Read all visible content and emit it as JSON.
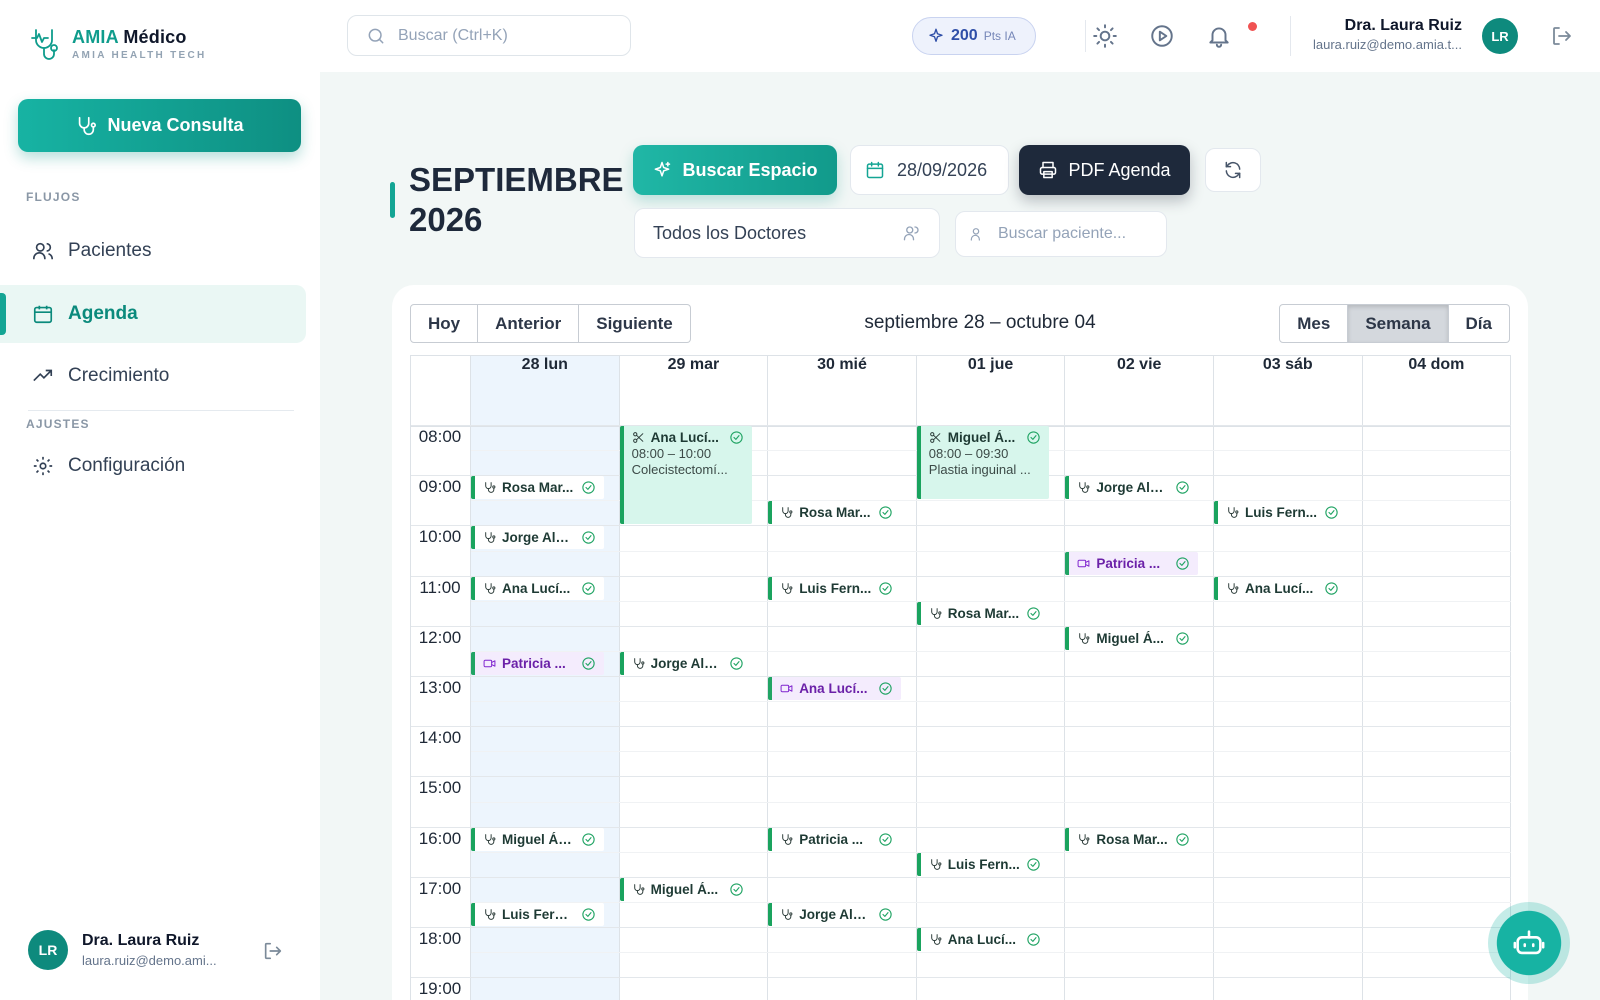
{
  "brand": {
    "title_a": "AMIA",
    "title_b": " Médico",
    "subtitle": "AMIA HEALTH TECH",
    "accent": "#0f9c8c"
  },
  "sidebar": {
    "new_consult": "Nueva Consulta",
    "section_flows": "FLUJOS",
    "section_settings": "AJUSTES",
    "items": [
      {
        "label": "Pacientes",
        "icon": "users-icon"
      },
      {
        "label": "Agenda",
        "icon": "calendar-icon",
        "active": true
      },
      {
        "label": "Crecimiento",
        "icon": "trending-up-icon"
      },
      {
        "label": "Configuración",
        "icon": "gear-icon"
      }
    ],
    "user": {
      "initials": "LR",
      "name": "Dra. Laura Ruiz",
      "email": "laura.ruiz@demo.ami..."
    }
  },
  "topbar": {
    "search_placeholder": "Buscar (Ctrl+K)",
    "points_value": "200",
    "points_label": "Pts IA",
    "user": {
      "initials": "LR",
      "name": "Dra. Laura Ruiz",
      "email": "laura.ruiz@demo.amia.t..."
    }
  },
  "page": {
    "month_line1": "SEPTIEMBRE",
    "month_line2": "2026",
    "find_slot": "Buscar Espacio",
    "date_value": "28/09/2026",
    "pdf": "PDF Agenda",
    "doctor_filter": "Todos los Doctores",
    "patient_search_placeholder": "Buscar paciente..."
  },
  "calendar": {
    "nav": [
      "Hoy",
      "Anterior",
      "Siguiente"
    ],
    "range_title": "septiembre 28 – octubre 04",
    "views": [
      "Mes",
      "Semana",
      "Día"
    ],
    "active_view": "Semana",
    "days": [
      "28 lun",
      "29 mar",
      "30 mié",
      "01 jue",
      "02 vie",
      "03 sáb",
      "04 dom"
    ],
    "hours": [
      "08:00",
      "09:00",
      "10:00",
      "11:00",
      "12:00",
      "13:00",
      "14:00",
      "15:00",
      "16:00",
      "17:00",
      "18:00",
      "19:00"
    ],
    "events": [
      {
        "day": 0,
        "start": "09:00",
        "name": "Rosa Mar...",
        "kind": "consult"
      },
      {
        "day": 0,
        "start": "10:00",
        "name": "Jorge Alb...",
        "kind": "consult"
      },
      {
        "day": 0,
        "start": "11:00",
        "name": "Ana Lucí...",
        "kind": "consult"
      },
      {
        "day": 0,
        "start": "12:30",
        "name": "Patricia ...",
        "kind": "video"
      },
      {
        "day": 0,
        "start": "16:00",
        "name": "Miguel Ánge...",
        "kind": "consult"
      },
      {
        "day": 0,
        "start": "17:30",
        "name": "Luis Fernand...",
        "kind": "consult"
      },
      {
        "day": 1,
        "start": "08:00",
        "end": "10:00",
        "name": "Ana Lucí...",
        "time": "08:00 – 10:00",
        "detail": "Colecistectomí...",
        "kind": "surgery"
      },
      {
        "day": 1,
        "start": "12:30",
        "name": "Jorge Alb...",
        "kind": "consult"
      },
      {
        "day": 1,
        "start": "17:00",
        "name": "Miguel Á...",
        "kind": "consult"
      },
      {
        "day": 2,
        "start": "09:30",
        "name": "Rosa Mar...",
        "kind": "consult"
      },
      {
        "day": 2,
        "start": "11:00",
        "name": "Luis Fern...",
        "kind": "consult"
      },
      {
        "day": 2,
        "start": "13:00",
        "name": "Ana Lucí...",
        "kind": "video"
      },
      {
        "day": 2,
        "start": "16:00",
        "name": "Patricia ...",
        "kind": "consult"
      },
      {
        "day": 2,
        "start": "17:30",
        "name": "Jorge Alb...",
        "kind": "consult"
      },
      {
        "day": 3,
        "start": "08:00",
        "end": "09:30",
        "name": "Miguel Á...",
        "time": "08:00 – 09:30",
        "detail": "Plastia inguinal ...",
        "kind": "surgery"
      },
      {
        "day": 3,
        "start": "11:30",
        "name": "Rosa Mar...",
        "kind": "consult"
      },
      {
        "day": 3,
        "start": "16:30",
        "name": "Luis Fern...",
        "kind": "consult"
      },
      {
        "day": 3,
        "start": "18:00",
        "name": "Ana Lucí...",
        "kind": "consult"
      },
      {
        "day": 4,
        "start": "09:00",
        "name": "Jorge Alb...",
        "kind": "consult"
      },
      {
        "day": 4,
        "start": "10:30",
        "name": "Patricia ...",
        "kind": "video"
      },
      {
        "day": 4,
        "start": "12:00",
        "name": "Miguel Á...",
        "kind": "consult"
      },
      {
        "day": 4,
        "start": "16:00",
        "name": "Rosa Mar...",
        "kind": "consult"
      },
      {
        "day": 5,
        "start": "09:30",
        "name": "Luis Fern...",
        "kind": "consult"
      },
      {
        "day": 5,
        "start": "11:00",
        "name": "Ana Lucí...",
        "kind": "consult"
      }
    ]
  },
  "colors": {
    "primary": "#14a594",
    "dark": "#1e293b",
    "confirmed": "#21a464",
    "video_bg": "#f4ecfd",
    "surgery_bg": "#d7f6ec",
    "today_bg": "#edf5fd"
  }
}
